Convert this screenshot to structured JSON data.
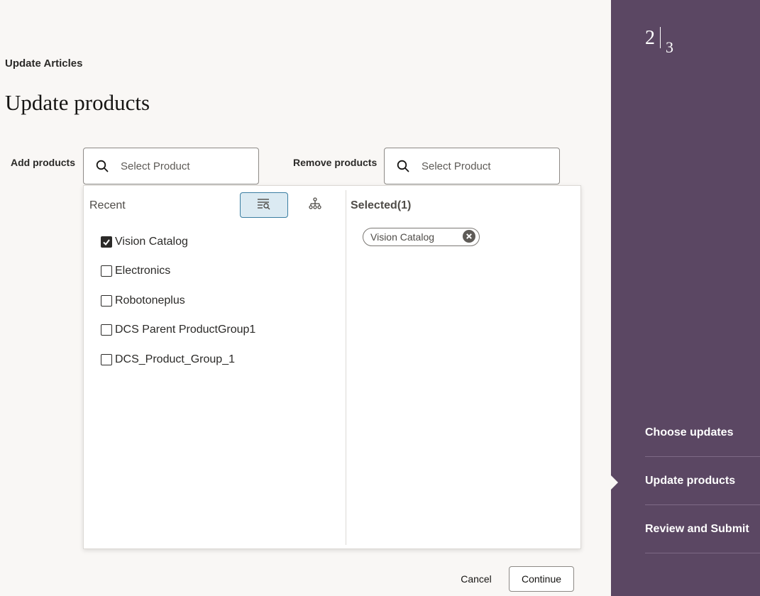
{
  "breadcrumb": "Update Articles",
  "page_title": "Update products",
  "add_products": {
    "label": "Add products",
    "placeholder": "Select Product"
  },
  "remove_products": {
    "label": "Remove products",
    "placeholder": "Select Product"
  },
  "dropdown": {
    "recent_heading": "Recent",
    "selected_heading": "Selected(1)",
    "items": [
      {
        "label": "Vision Catalog",
        "checked": true
      },
      {
        "label": "Electronics",
        "checked": false
      },
      {
        "label": "Robotoneplus",
        "checked": false
      },
      {
        "label": "DCS Parent ProductGroup1",
        "checked": false
      },
      {
        "label": "DCS_Product_Group_1",
        "checked": false
      }
    ],
    "selected_chips": [
      "Vision Catalog"
    ]
  },
  "footer": {
    "cancel_label": "Cancel",
    "continue_label": "Continue"
  },
  "train": {
    "current_step": "2",
    "total_steps": "3",
    "steps": [
      "Choose updates",
      "Update products",
      "Review and Submit"
    ],
    "current_index": 1
  },
  "colors": {
    "sidebar_bg": "#5b4763",
    "page_bg": "#f9f7f5",
    "active_view_bg": "#dbeaf2",
    "active_view_border": "#3a7ea1"
  },
  "icons": {
    "search": "search-icon",
    "list_view": "list-search-icon",
    "tree_view": "hierarchy-icon",
    "check": "check-icon",
    "clear": "clear-icon"
  }
}
